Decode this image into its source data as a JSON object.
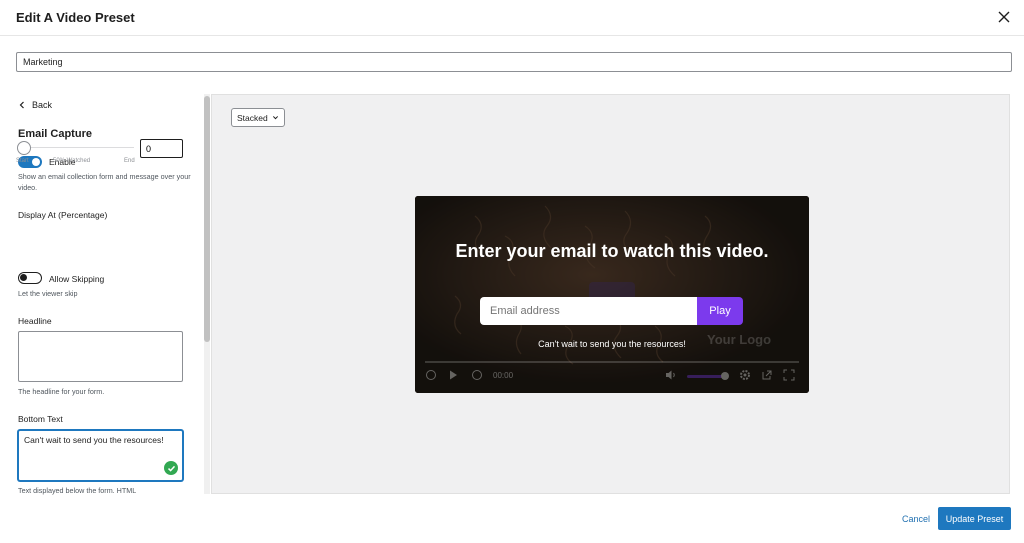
{
  "modal": {
    "title": "Edit A Video Preset"
  },
  "preset": {
    "name": "Marketing"
  },
  "sidebar": {
    "back_label": "Back",
    "section_title": "Email Capture",
    "enable": {
      "label": "Enable",
      "checked": true,
      "help": "Show an email collection form and message over your video."
    },
    "display_at": {
      "label": "Display At (Percentage)",
      "value": "0",
      "slider_fraction": 0.0,
      "tick_labels": [
        "Start",
        "50% Watched",
        "End"
      ]
    },
    "allow_skipping": {
      "label": "Allow Skipping",
      "checked": false,
      "help": "Let the viewer skip"
    },
    "headline": {
      "label": "Headline",
      "value": "",
      "help": "The headline for your form."
    },
    "bottom_text": {
      "label": "Bottom Text",
      "value": "Can't wait to send you the resources!",
      "help": "Text displayed below the form. HTML"
    }
  },
  "preview": {
    "layout_select": "Stacked",
    "player": {
      "headline": "Enter your email to watch this video.",
      "email_placeholder": "Email address",
      "button_label": "Play",
      "bottom_text": "Can't wait to send you the resources!",
      "logo_text": "Your Logo",
      "time": "00:00",
      "accent_color": "#7c3aed"
    }
  },
  "footer": {
    "cancel_label": "Cancel",
    "update_label": "Update Preset"
  },
  "colors": {
    "primary": "#1e78bf",
    "link": "#2271b1",
    "success": "#32a852"
  }
}
